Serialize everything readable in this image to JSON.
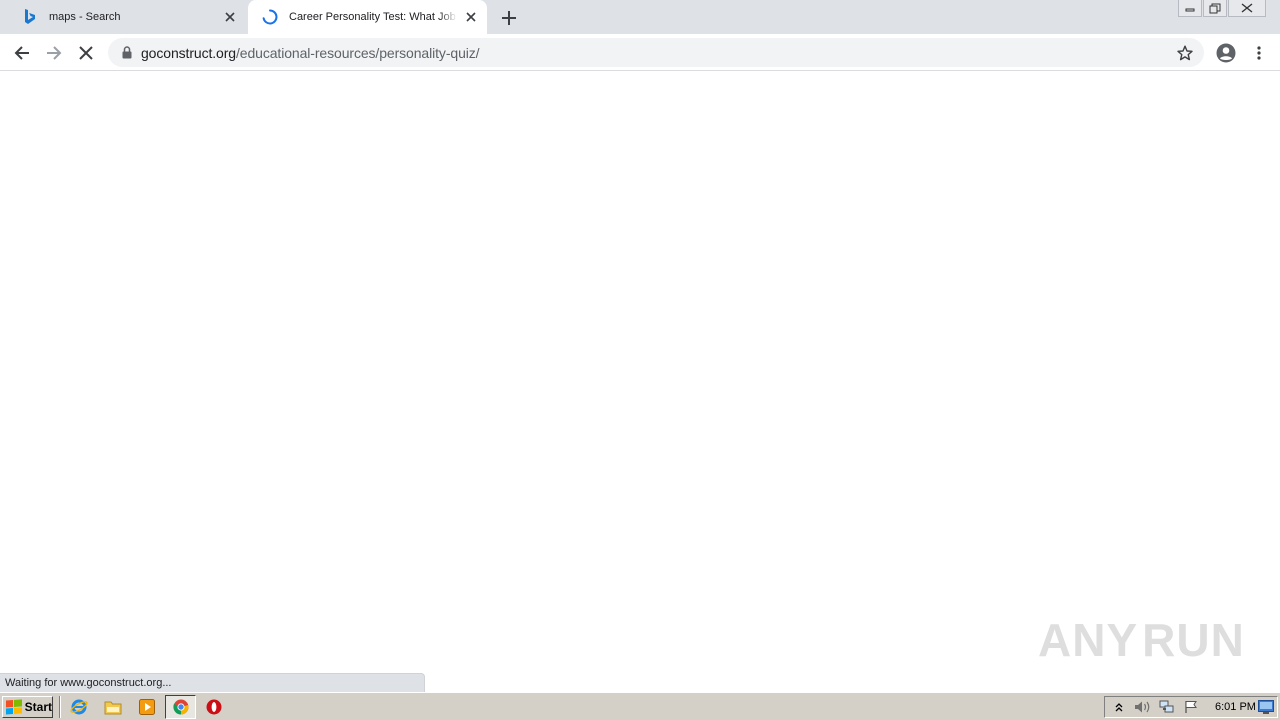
{
  "browser": {
    "tabs": [
      {
        "title": "maps - Search",
        "favicon": "bing-icon",
        "active": false
      },
      {
        "title": "Career Personality Test: What Job S",
        "favicon": "loading-spinner-icon",
        "active": true
      }
    ],
    "new_tab_icon": "plus-icon",
    "window_controls": [
      "minimize-icon",
      "restore-icon",
      "close-icon"
    ]
  },
  "toolbar": {
    "back_icon": "arrow-left-icon",
    "forward_icon": "arrow-right-icon",
    "stop_icon": "stop-x-icon",
    "url_host": "goconstruct.org",
    "url_path": "/educational-resources/personality-quiz/",
    "lock_icon": "lock-icon",
    "bookmark_icon": "star-icon",
    "profile_icon": "account-circle-icon",
    "menu_icon": "kebab-menu-icon"
  },
  "status": {
    "text": "Waiting for www.goconstruct.org..."
  },
  "watermark": {
    "text_left": "ANY",
    "text_right": "RUN"
  },
  "taskbar": {
    "start_label": "Start",
    "quick_launch": [
      "internet-explorer-icon",
      "folder-icon",
      "media-player-icon",
      "chrome-icon",
      "opera-icon"
    ],
    "tray_icons": [
      "up-arrow-icon",
      "speaker-icon",
      "network-icon",
      "flag-icon"
    ],
    "clock": "6:01 PM"
  },
  "colors": {
    "tabstrip": "#dee1e6",
    "accent_blue": "#1a73e8",
    "taskbar": "#d4d0c8"
  }
}
